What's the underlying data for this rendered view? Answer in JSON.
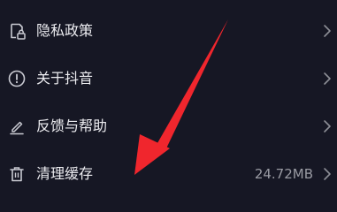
{
  "settings": {
    "items": [
      {
        "label": "隐私政策",
        "icon": "privacy-lock-icon",
        "value": ""
      },
      {
        "label": "关于抖音",
        "icon": "info-icon",
        "value": ""
      },
      {
        "label": "反馈与帮助",
        "icon": "edit-feedback-icon",
        "value": ""
      },
      {
        "label": "清理缓存",
        "icon": "trash-icon",
        "value": "24.72MB"
      }
    ]
  },
  "colors": {
    "background": "#161724",
    "text": "#ececf0",
    "secondary_text": "#9a9ba3",
    "annotation_arrow": "#f0262d"
  }
}
